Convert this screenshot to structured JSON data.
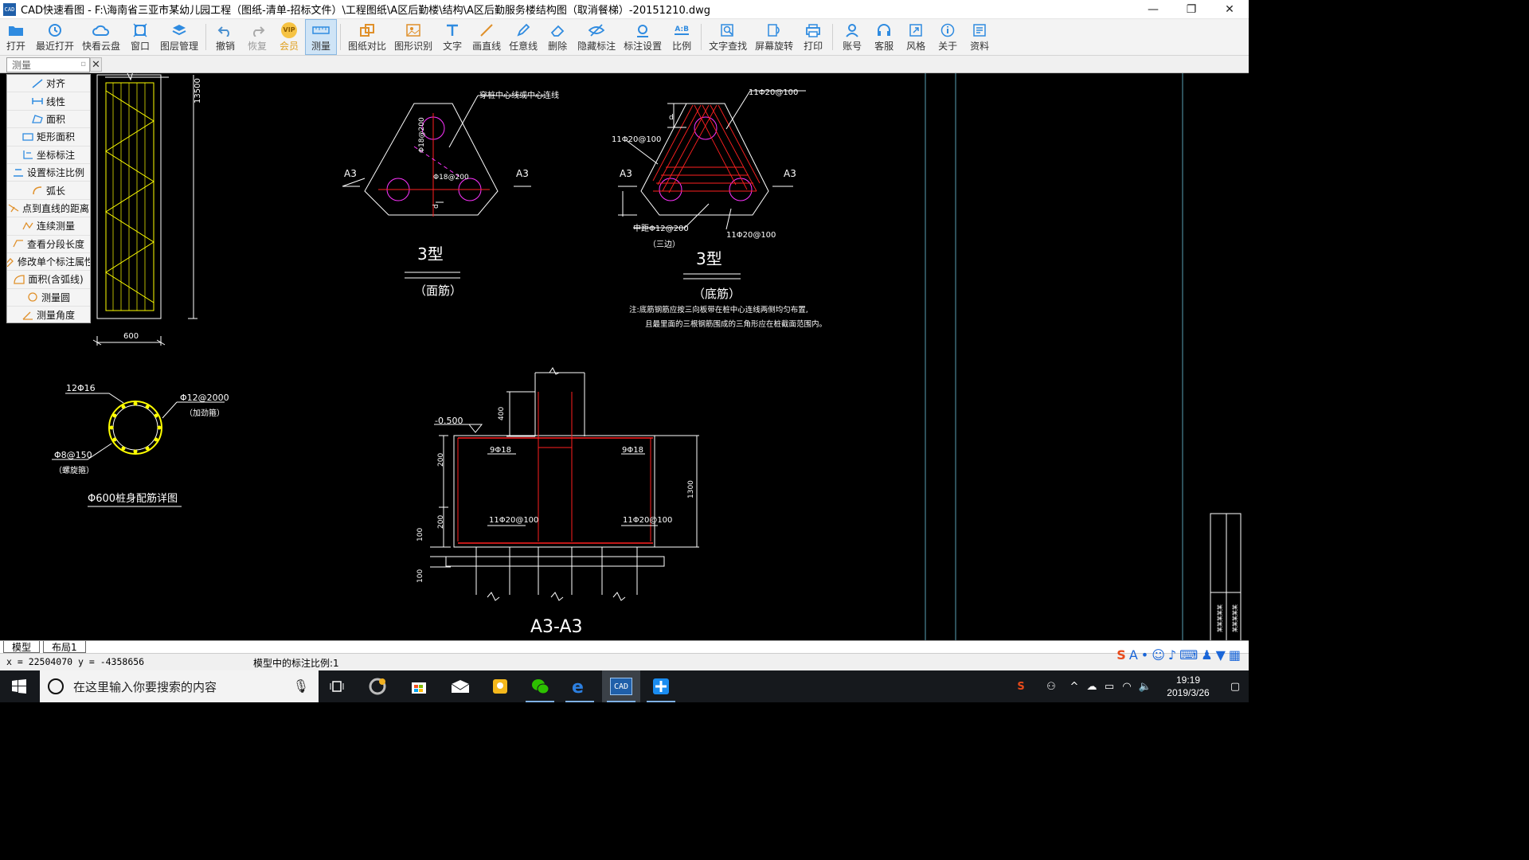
{
  "window": {
    "title": "CAD快速看图 - F:\\海南省三亚市某幼儿园工程（图纸-清单-招标文件）\\工程图纸\\A区后勤楼\\结构\\A区后勤服务楼结构图（取消餐梯）-20151210.dwg",
    "app_icon_text": "CAD",
    "minimize": "—",
    "maximize": "❐",
    "close": "✕"
  },
  "toolbar": {
    "open": "打开",
    "recent": "最近打开",
    "cloud": "快看云盘",
    "window": "窗口",
    "layers": "图层管理",
    "undo": "撤销",
    "redo": "恢复",
    "vip": "会员",
    "measure": "测量",
    "compare": "图纸对比",
    "recognize": "图形识别",
    "text": "文字",
    "line": "画直线",
    "freehand": "任意线",
    "delete": "删除",
    "hide_dim": "隐藏标注",
    "dim_settings": "标注设置",
    "scale": "比例",
    "find_text": "文字查找",
    "rotate": "屏幕旋转",
    "print": "打印",
    "account": "账号",
    "service": "客服",
    "style": "风格",
    "about": "关于",
    "docs": "资料",
    "vip_badge": "VIP",
    "scale_badge": "A:B"
  },
  "measure_panel": {
    "tab_title": "测量",
    "items": [
      "对齐",
      "线性",
      "面积",
      "矩形面积",
      "坐标标注",
      "设置标注比例",
      "弧长",
      "点到直线的距离",
      "连续测量",
      "查看分段长度",
      "修改单个标注属性",
      "面积(含弧线)",
      "测量圆",
      "测量角度"
    ]
  },
  "drawing": {
    "dim_13500": "13500",
    "dim_600": "600",
    "t3_left_a": "A3",
    "t3_left_b": "A3",
    "t3_left_note": "穿桩中心线或中心连线",
    "t3_left_bar1": "Φ18@200",
    "t3_left_bar2": "Φ18@200",
    "t3_left_d": "d",
    "t3_left_title": "3型",
    "t3_left_sub": "（面筋）",
    "t3_right_a": "A3",
    "t3_right_b": "A3",
    "t3_right_bar1": "11Φ20@100",
    "t3_right_bar2": "11Φ20@100",
    "t3_right_bar3": "11Φ20@100",
    "t3_right_mid": "中距Φ12@200",
    "t3_right_mid2": "（三边）",
    "t3_right_d": "d",
    "t3_right_title": "3型",
    "t3_right_sub": "（底筋）",
    "note_line1": "注:底筋钢筋应按三向板带在桩中心连线两侧均匀布置,",
    "note_line2": "且最里面的三根钢筋围成的三角形应在桩截面范围内。",
    "pile_main": "12Φ16",
    "pile_hoop": "Φ12@2000",
    "pile_hoop_sub": "（加劲箍）",
    "pile_spiral": "Φ8@150",
    "pile_spiral_sub": "（螺旋箍）",
    "pile_title": "Φ600桩身配筋详图",
    "sec_level": "-0.500",
    "sec_400": "400",
    "sec_200a": "200",
    "sec_200b": "200",
    "sec_100a": "100",
    "sec_100b": "100",
    "sec_1300": "1300",
    "sec_bar_l": "9Φ18",
    "sec_bar_r": "9Φ18",
    "sec_bot_l": "11Φ20@100",
    "sec_bot_r": "11Φ20@100",
    "sec_title": "A3-A3",
    "tb_text1": "某某某某某",
    "tb_text2": "某某某某某"
  },
  "tabs": {
    "model": "模型",
    "layout1": "布局1"
  },
  "status": {
    "coords": "x = 22504070  y = -4358656",
    "scale_text": "模型中的标注比例:1"
  },
  "taskbar": {
    "search_placeholder": "在这里输入你要搜索的内容",
    "time": "19:19",
    "date": "2019/3/26",
    "cad_label": "CAD"
  },
  "colors": {
    "canvas": "#000000",
    "yellow": "#ffff00",
    "magenta": "#ff33ff",
    "red": "#ff2020",
    "white": "#ffffff",
    "accent": "#1f5fa9",
    "taskbar": "#16191d"
  }
}
